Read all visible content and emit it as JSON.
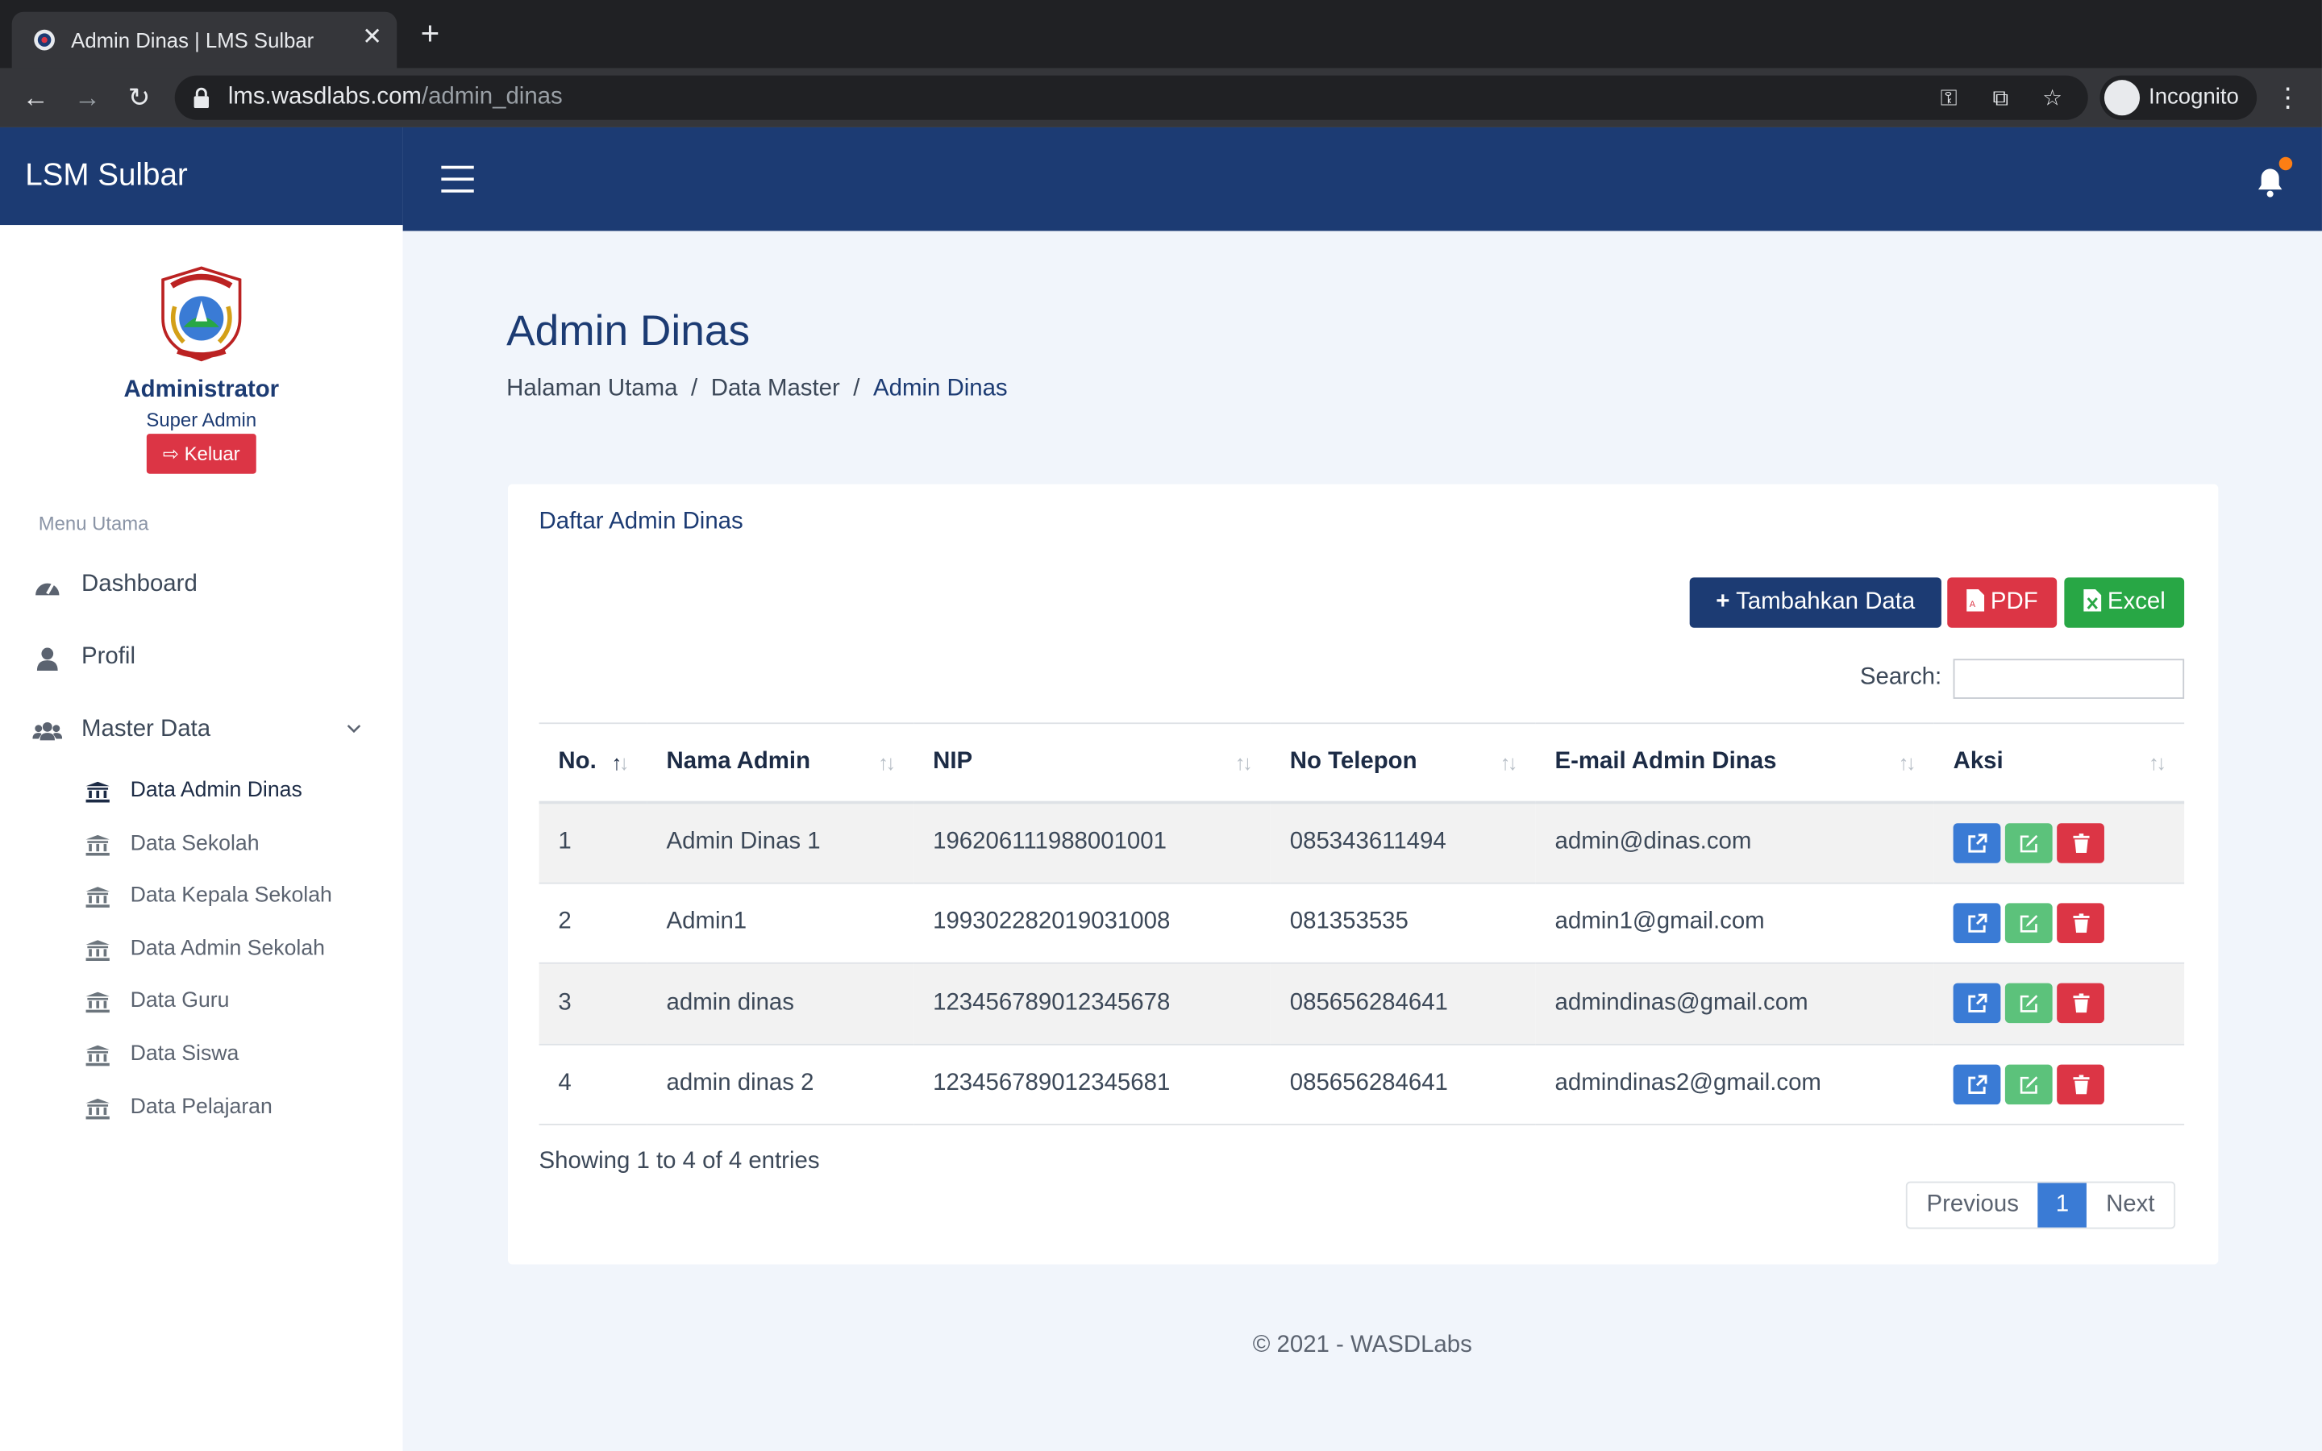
{
  "browser": {
    "tab_title": "Admin Dinas | LMS Sulbar",
    "url_host": "lms.wasdlabs.com",
    "url_path": "/admin_dinas",
    "profile_label": "Incognito"
  },
  "app": {
    "brand": "LSM Sulbar",
    "user": {
      "name": "Administrator",
      "role": "Super Admin",
      "logout_label": "Keluar"
    }
  },
  "sidebar": {
    "section_label": "Menu Utama",
    "items": [
      {
        "label": "Dashboard",
        "icon": "tachometer-icon"
      },
      {
        "label": "Profil",
        "icon": "user-icon"
      },
      {
        "label": "Master Data",
        "icon": "users-icon",
        "expanded": true
      }
    ],
    "subitems": [
      {
        "label": "Data Admin Dinas",
        "active": true
      },
      {
        "label": "Data Sekolah"
      },
      {
        "label": "Data Kepala Sekolah"
      },
      {
        "label": "Data Admin Sekolah"
      },
      {
        "label": "Data Guru"
      },
      {
        "label": "Data Siswa"
      },
      {
        "label": "Data Pelajaran"
      }
    ]
  },
  "page": {
    "title": "Admin Dinas",
    "breadcrumb": [
      "Halaman Utama",
      "Data Master",
      "Admin Dinas"
    ]
  },
  "card": {
    "title": "Daftar Admin Dinas",
    "buttons": {
      "add": "Tambahkan Data",
      "pdf": "PDF",
      "excel": "Excel"
    },
    "search_label": "Search:",
    "search_value": "",
    "columns": [
      "No.",
      "Nama Admin",
      "NIP",
      "No Telepon",
      "E-mail Admin Dinas",
      "Aksi"
    ],
    "rows": [
      [
        "1",
        "Admin Dinas 1",
        "196206111988001001",
        "085343611494",
        "admin@dinas.com"
      ],
      [
        "2",
        "Admin1",
        "199302282019031008",
        "081353535",
        "admin1@gmail.com"
      ],
      [
        "3",
        "admin dinas",
        "123456789012345678",
        "085656284641",
        "admindinas@gmail.com"
      ],
      [
        "4",
        "admin dinas 2",
        "123456789012345681",
        "085656284641",
        "admindinas2@gmail.com"
      ]
    ],
    "showing": "Showing 1 to 4 of 4 entries",
    "pagination": {
      "previous": "Previous",
      "page": "1",
      "next": "Next"
    }
  },
  "footer": "© 2021 - WASDLabs",
  "colors": {
    "primary": "#1c3b73",
    "danger": "#dc3545",
    "success": "#28a745",
    "info": "#3a7bd5",
    "edit": "#5cc27b",
    "notification": "#fd7e14"
  }
}
